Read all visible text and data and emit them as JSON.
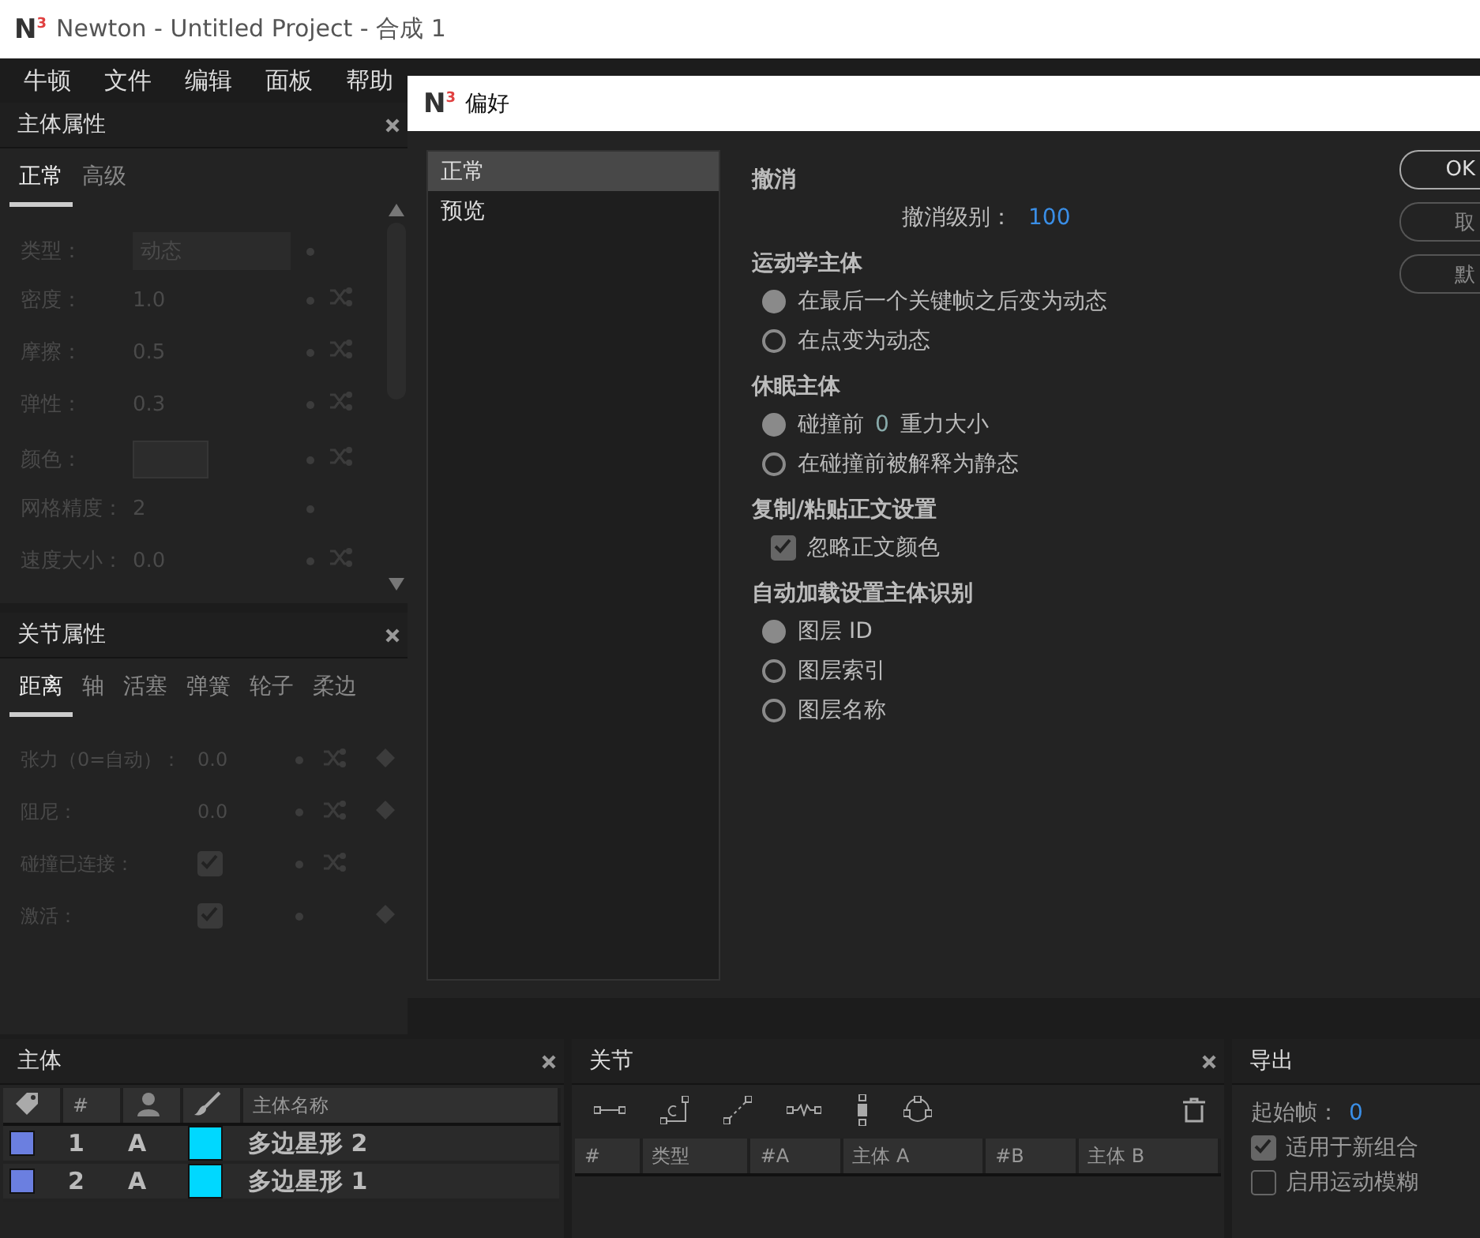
{
  "window": {
    "logo": {
      "letter": "N",
      "sup": "3"
    },
    "title": "Newton - Untitled Project - 合成 1"
  },
  "menu": [
    "牛顿",
    "文件",
    "编辑",
    "面板",
    "帮助"
  ],
  "body_properties": {
    "title": "主体属性",
    "tabs": [
      {
        "label": "正常",
        "selected": true
      },
      {
        "label": "高级",
        "selected": false
      }
    ],
    "rows": [
      {
        "kind": "dropdown",
        "label": "类型：",
        "value": "动态",
        "shuffle": false,
        "keyframe": false
      },
      {
        "kind": "value",
        "label": "密度：",
        "value": "1.0",
        "shuffle": true,
        "keyframe": false
      },
      {
        "kind": "value",
        "label": "摩擦：",
        "value": "0.5",
        "shuffle": true,
        "keyframe": false
      },
      {
        "kind": "value",
        "label": "弹性：",
        "value": "0.3",
        "shuffle": true,
        "keyframe": false
      },
      {
        "kind": "color",
        "label": "颜色：",
        "shuffle": true,
        "keyframe": false
      },
      {
        "kind": "value",
        "label": "网格精度：",
        "value": "2",
        "shuffle": false,
        "keyframe": false
      },
      {
        "kind": "value",
        "label": "速度大小：",
        "value": "0.0",
        "shuffle": true,
        "keyframe": false
      }
    ]
  },
  "joint_properties": {
    "title": "关节属性",
    "tabs": [
      {
        "label": "距离",
        "selected": true
      },
      {
        "label": "轴",
        "selected": false
      },
      {
        "label": "活塞",
        "selected": false
      },
      {
        "label": "弹簧",
        "selected": false
      },
      {
        "label": "轮子",
        "selected": false
      },
      {
        "label": "柔边",
        "selected": false
      }
    ],
    "rows": [
      {
        "kind": "value",
        "label": "张力（0=自动）：",
        "value": "0.0",
        "shuffle": true,
        "keyframe": true
      },
      {
        "kind": "value",
        "label": "阻尼：",
        "value": "0.0",
        "shuffle": true,
        "keyframe": true
      },
      {
        "kind": "checkbox",
        "label": "碰撞已连接：",
        "checked": true,
        "shuffle": true,
        "keyframe": false
      },
      {
        "kind": "checkbox",
        "label": "激活：",
        "checked": true,
        "shuffle": false,
        "keyframe": true
      }
    ]
  },
  "preferences": {
    "logo": {
      "letter": "N",
      "sup": "3"
    },
    "title": "偏好",
    "categories": [
      {
        "label": "正常",
        "selected": true
      },
      {
        "label": "预览",
        "selected": false
      }
    ],
    "sections": [
      {
        "heading": "撤消",
        "items": [
          {
            "kind": "number",
            "label": "撤消级别：",
            "value": "100"
          }
        ]
      },
      {
        "heading": "运动学主体",
        "items": [
          {
            "kind": "radio",
            "label": "在最后一个关键帧之后变为动态",
            "selected": true
          },
          {
            "kind": "radio",
            "label": "在点变为动态",
            "selected": false
          }
        ]
      },
      {
        "heading": "休眠主体",
        "items": [
          {
            "kind": "radio_number",
            "before": "碰撞前",
            "value": "0",
            "after": "重力大小",
            "selected": true
          },
          {
            "kind": "radio",
            "label": "在碰撞前被解释为静态",
            "selected": false
          }
        ]
      },
      {
        "heading": "复制/粘贴正文设置",
        "items": [
          {
            "kind": "checkbox",
            "label": "忽略正文颜色",
            "checked": true
          }
        ]
      },
      {
        "heading": "自动加载设置主体识别",
        "items": [
          {
            "kind": "radio",
            "label": "图层 ID",
            "selected": true
          },
          {
            "kind": "radio",
            "label": "图层索引",
            "selected": false
          },
          {
            "kind": "radio",
            "label": "图层名称",
            "selected": false
          }
        ]
      }
    ],
    "buttons": [
      "OK",
      "取",
      "默"
    ]
  },
  "bodies": {
    "title": "主体",
    "columns": [
      "#",
      "主体名称"
    ],
    "rows": [
      {
        "label": {
          "color": "#6b7fe0"
        },
        "number": "1",
        "group": "A",
        "color": "#00d8ff",
        "name": "多边星形 2"
      },
      {
        "label": {
          "color": "#6b7fe0"
        },
        "number": "2",
        "group": "A",
        "color": "#00d8ff",
        "name": "多边星形 1"
      }
    ]
  },
  "joints": {
    "title": "关节",
    "columns": [
      "#",
      "类型",
      "#A",
      "主体 A",
      "#B",
      "主体 B"
    ]
  },
  "export": {
    "title": "导出",
    "start_label": "起始帧：",
    "start_value": "0",
    "options": [
      {
        "label": "适用于新组合",
        "checked": true
      },
      {
        "label": "启用运动模糊",
        "checked": false
      }
    ]
  }
}
